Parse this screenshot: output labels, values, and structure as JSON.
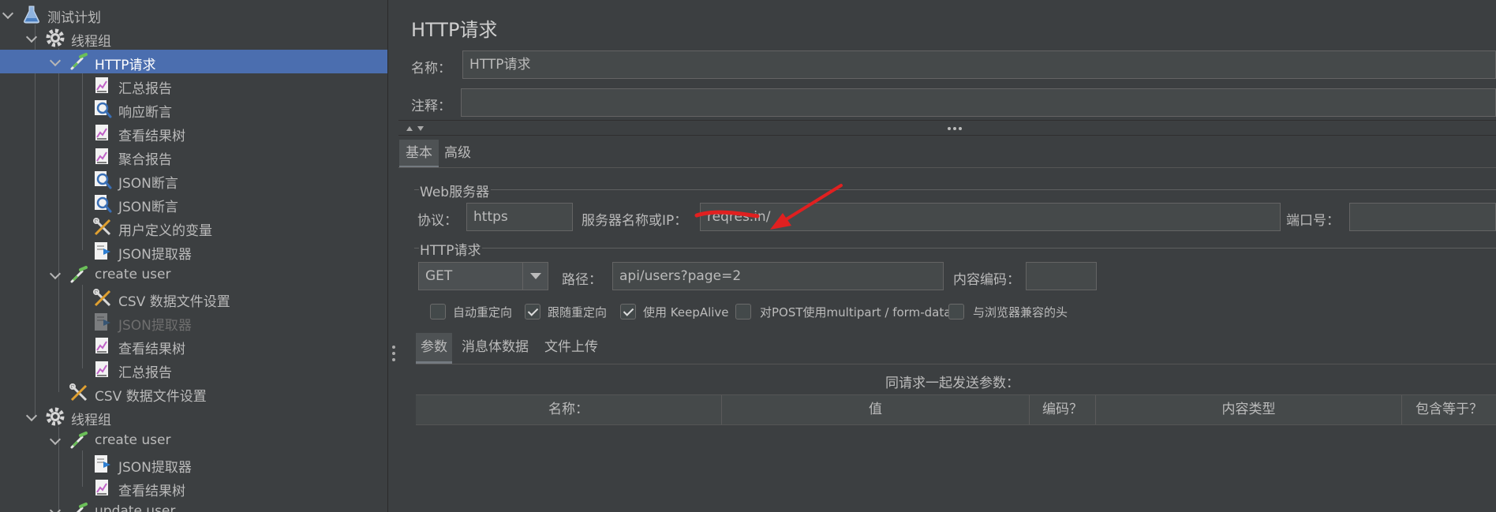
{
  "tree": {
    "items": [
      {
        "label": "测试计划",
        "icon": "flask-icon",
        "expanded": true
      },
      {
        "label": "线程组",
        "icon": "gear-icon",
        "expanded": true
      },
      {
        "label": "HTTP请求",
        "icon": "dropper-icon",
        "expanded": true,
        "selected": true
      },
      {
        "label": "汇总报告",
        "icon": "chart-icon"
      },
      {
        "label": "响应断言",
        "icon": "magnifier-icon"
      },
      {
        "label": "查看结果树",
        "icon": "chart-icon"
      },
      {
        "label": "聚合报告",
        "icon": "chart-icon"
      },
      {
        "label": "JSON断言",
        "icon": "magnifier-icon"
      },
      {
        "label": "JSON断言",
        "icon": "magnifier-icon"
      },
      {
        "label": "用户定义的变量",
        "icon": "wrench-icon"
      },
      {
        "label": "JSON提取器",
        "icon": "extractor-icon"
      },
      {
        "label": "create user",
        "icon": "dropper-icon",
        "expanded": true
      },
      {
        "label": "CSV 数据文件设置",
        "icon": "wrench-icon"
      },
      {
        "label": "JSON提取器",
        "icon": "extractor-icon",
        "disabled": true
      },
      {
        "label": "查看结果树",
        "icon": "chart-icon"
      },
      {
        "label": "汇总报告",
        "icon": "chart-icon"
      },
      {
        "label": "CSV 数据文件设置",
        "icon": "wrench-icon"
      },
      {
        "label": "线程组",
        "icon": "gear-icon",
        "expanded": true
      },
      {
        "label": "create user",
        "icon": "dropper-icon",
        "expanded": true
      },
      {
        "label": "JSON提取器",
        "icon": "extractor-icon"
      },
      {
        "label": "查看结果树",
        "icon": "chart-icon"
      },
      {
        "label": "update user",
        "icon": "dropper-icon",
        "expanded": true
      }
    ]
  },
  "panel": {
    "title": "HTTP请求",
    "name_label": "名称：",
    "name_value": "HTTP请求",
    "comment_label": "注释：",
    "comment_value": "",
    "tabs": [
      "基本",
      "高级"
    ],
    "web_server": {
      "group_title": "Web服务器",
      "protocol_label": "协议：",
      "protocol_value": "https",
      "server_label": "服务器名称或IP：",
      "server_value": "reqres.in/",
      "port_label": "端口号：",
      "port_value": ""
    },
    "http_request": {
      "group_title": "HTTP请求",
      "method_value": "GET",
      "path_label": "路径：",
      "path_value": "api/users?page=2",
      "encoding_label": "内容编码：",
      "encoding_value": ""
    },
    "checkboxes": [
      {
        "label": "自动重定向",
        "checked": false
      },
      {
        "label": "跟随重定向",
        "checked": true
      },
      {
        "label": "使用 KeepAlive",
        "checked": true
      },
      {
        "label": "对POST使用multipart / form-data",
        "checked": false
      },
      {
        "label": "与浏览器兼容的头",
        "checked": false
      }
    ],
    "sub_tabs": [
      "参数",
      "消息体数据",
      "文件上传"
    ],
    "params_caption": "同请求一起发送参数：",
    "table_headers": [
      "名称：",
      "值",
      "编码？",
      "内容类型",
      "包含等于？"
    ]
  },
  "colors": {
    "background": "#3c3f41",
    "selection": "#4b6eaf",
    "annotation_arrow": "#e02020"
  }
}
